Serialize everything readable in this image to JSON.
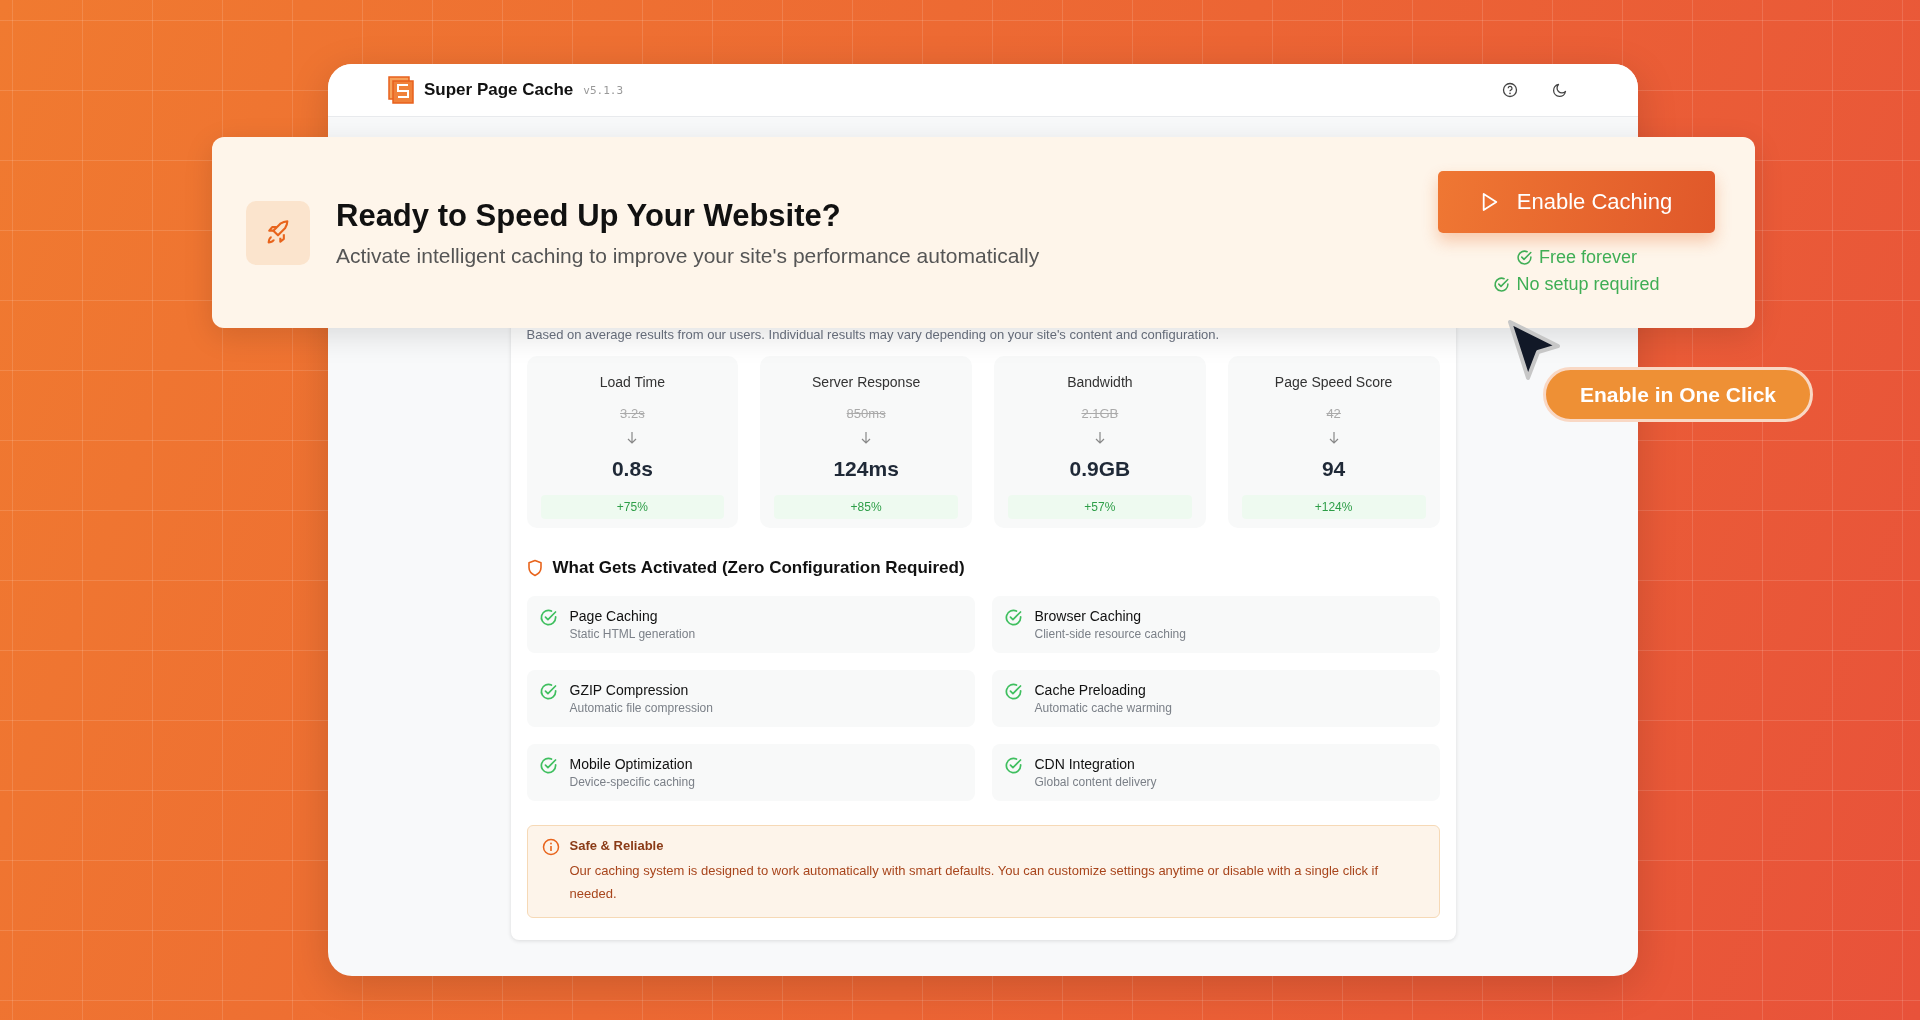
{
  "app": {
    "name": "Super Page Cache",
    "version": "v5.1.3"
  },
  "banner": {
    "title": "Ready to Speed Up Your Website?",
    "subtitle": "Activate intelligent caching to improve your site's performance automatically",
    "button": "Enable Caching",
    "perks": [
      "Free forever",
      "No setup required"
    ]
  },
  "disclaimer": "Based on average results from our users. Individual results may vary depending on your site's content and configuration.",
  "stats": [
    {
      "label": "Load Time",
      "before": "3.2s",
      "after": "0.8s",
      "improvement": "+75%"
    },
    {
      "label": "Server Response",
      "before": "850ms",
      "after": "124ms",
      "improvement": "+85%"
    },
    {
      "label": "Bandwidth",
      "before": "2.1GB",
      "after": "0.9GB",
      "improvement": "+57%"
    },
    {
      "label": "Page Speed Score",
      "before": "42",
      "after": "94",
      "improvement": "+124%"
    }
  ],
  "features_title": "What Gets Activated (Zero Configuration Required)",
  "features": [
    {
      "title": "Page Caching",
      "description": "Static HTML generation"
    },
    {
      "title": "Browser Caching",
      "description": "Client-side resource caching"
    },
    {
      "title": "GZIP Compression",
      "description": "Automatic file compression"
    },
    {
      "title": "Cache Preloading",
      "description": "Automatic cache warming"
    },
    {
      "title": "Mobile Optimization",
      "description": "Device-specific caching"
    },
    {
      "title": "CDN Integration",
      "description": "Global content delivery"
    }
  ],
  "notice": {
    "title": "Safe & Reliable",
    "text": "Our caching system is designed to work automatically with smart defaults. You can customize settings anytime or disable with a single click if needed."
  },
  "callout": "Enable in One Click"
}
